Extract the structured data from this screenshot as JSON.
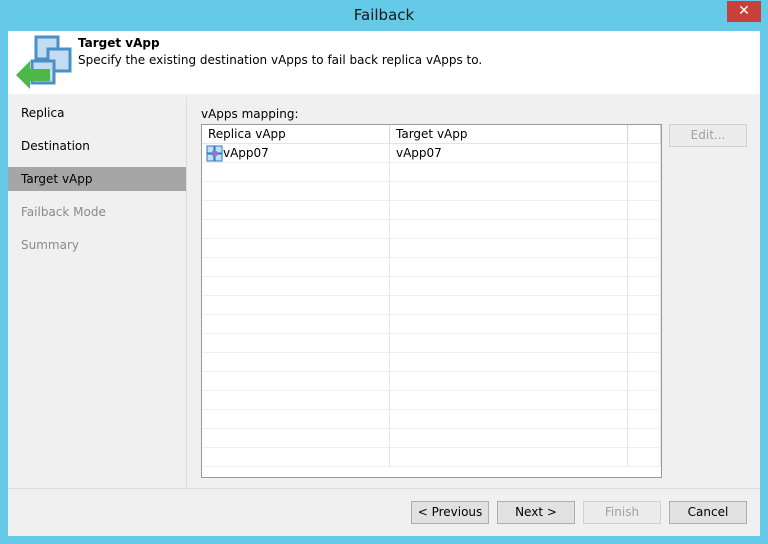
{
  "window": {
    "title": "Failback",
    "close": "✕"
  },
  "header": {
    "title": "Target vApp",
    "description": "Specify the existing destination vApps to fail back replica vApps to."
  },
  "sidebar": {
    "items": [
      {
        "label": "Replica",
        "state": "done"
      },
      {
        "label": "Destination",
        "state": "done"
      },
      {
        "label": "Target vApp",
        "state": "active"
      },
      {
        "label": "Failback Mode",
        "state": "pending"
      },
      {
        "label": "Summary",
        "state": "pending"
      }
    ]
  },
  "main": {
    "label": "vApps mapping:",
    "columns": [
      "Replica vApp",
      "Target vApp"
    ],
    "rows": [
      {
        "replica": "vApp07",
        "target": "vApp07",
        "icon": "vapp-icon"
      }
    ],
    "edit_label": "Edit..."
  },
  "footer": {
    "previous": "< Previous",
    "next": "Next >",
    "finish": "Finish",
    "cancel": "Cancel"
  }
}
